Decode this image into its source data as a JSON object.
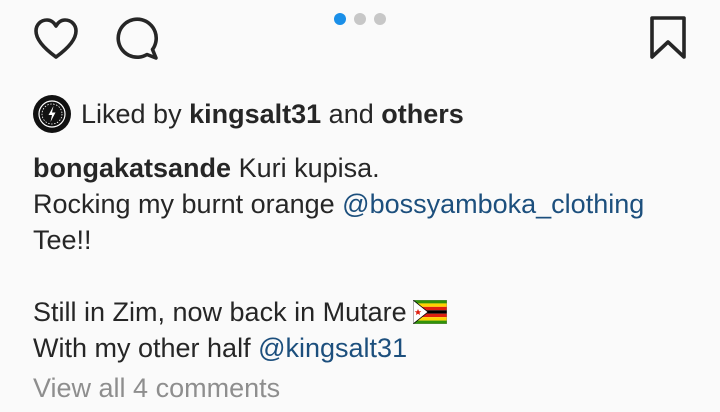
{
  "actions": {
    "like_icon": "heart-outline",
    "comment_icon": "speech-bubble-outline",
    "save_icon": "bookmark-outline"
  },
  "carousel": {
    "total": 3,
    "active_index": 0,
    "active_color": "#1a8fe8",
    "inactive_color": "#c7c7c7"
  },
  "likes": {
    "prefix": "Liked by",
    "user": "kingsalt31",
    "connector": "and",
    "others": "others"
  },
  "caption": {
    "author": "bongakatsande",
    "line1_text": "Kuri kupisa.",
    "line2_text": "Rocking my burnt orange",
    "line2_mention": "@bossyamboka_clothing",
    "line3_text": "Tee!!",
    "line4_text": "Still in Zim, now back in Mutare",
    "line4_emoji": "zimbabwe-flag",
    "line5_text": "With my other half",
    "line5_mention": "@kingsalt31"
  },
  "comments": {
    "view_all": "View all 4 comments"
  },
  "colors": {
    "text": "#262626",
    "mention": "#1c4f7d",
    "muted": "#8e8e8e",
    "background": "#fafafa"
  }
}
